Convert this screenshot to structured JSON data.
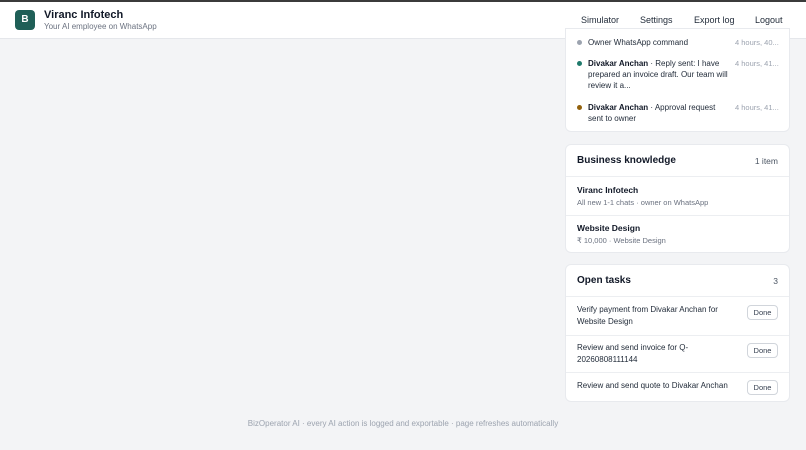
{
  "header": {
    "logo_letter": "B",
    "title": "Viranc Infotech",
    "subtitle": "Your AI employee on WhatsApp",
    "nav": [
      "Simulator",
      "Settings",
      "Export log",
      "Logout"
    ]
  },
  "activity": {
    "items": [
      {
        "name": "",
        "text": "Owner WhatsApp command",
        "time": "4 hours, 40...",
        "dot_color": "#9ca3af"
      },
      {
        "name": "Divakar Anchan",
        "text": " · Reply sent: I have prepared an invoice draft. Our team will review it a...",
        "time": "4 hours, 41...",
        "dot_color": "#1f7a6c"
      },
      {
        "name": "Divakar Anchan",
        "text": " · Approval request sent to owner",
        "time": "4 hours, 41...",
        "dot_color": "#92610c"
      }
    ]
  },
  "knowledge": {
    "title": "Business knowledge",
    "count": "1 item",
    "items": [
      {
        "name": "Viranc Infotech",
        "sub": "All new 1-1 chats · owner on WhatsApp"
      },
      {
        "name": "Website Design",
        "sub": "₹ 10,000 · Website Design"
      }
    ]
  },
  "tasks": {
    "title": "Open tasks",
    "count": "3",
    "done_label": "Done",
    "items": [
      "Verify payment from Divakar Anchan for Website Design",
      "Review and send invoice for Q-20260808111144",
      "Review and send quote to Divakar Anchan"
    ]
  },
  "footer": "BizOperator AI · every AI action is logged and exportable · page refreshes automatically"
}
